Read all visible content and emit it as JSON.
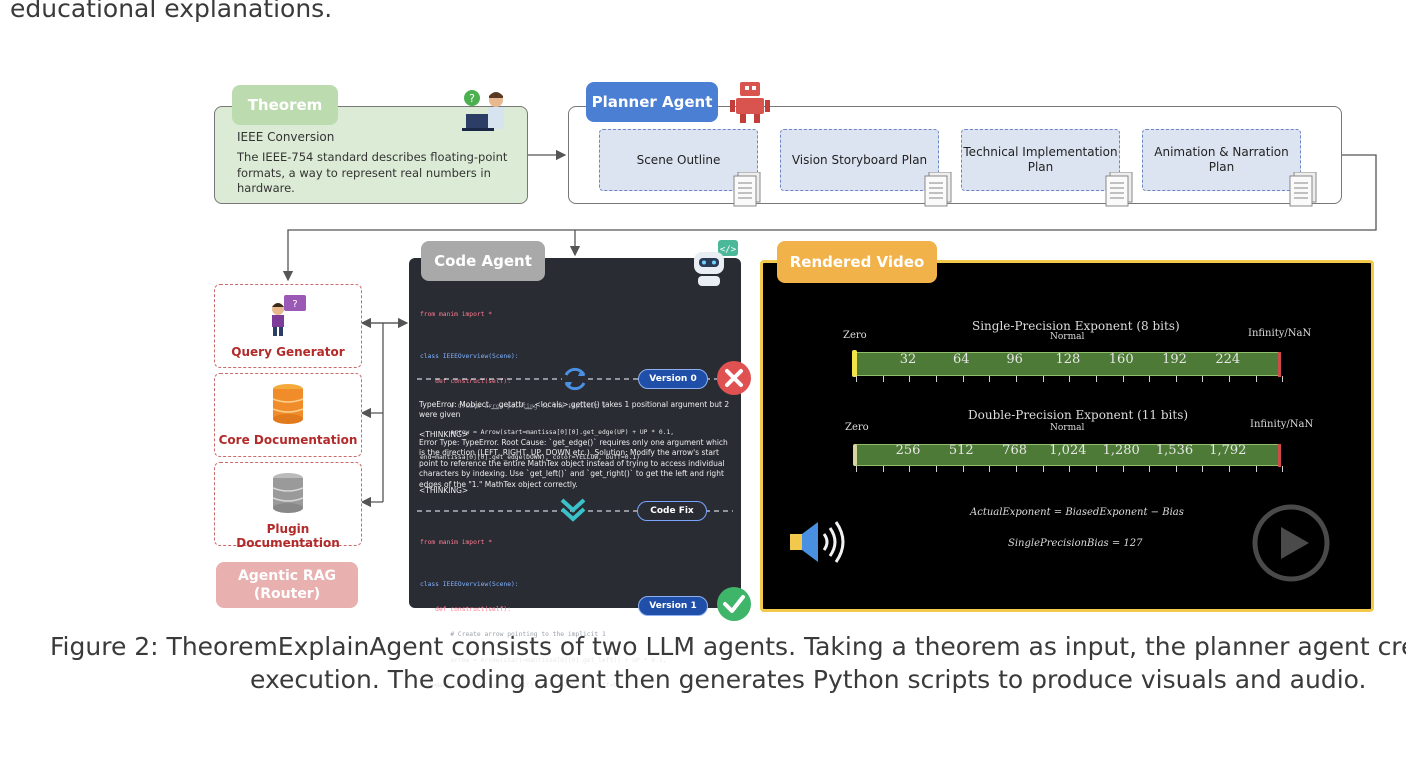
{
  "page": {
    "top_text": "educational explanations.",
    "caption_line1": "Figure 2: TheoremExplainAgent consists of two LLM agents. Taking a theorem as input, the planner agent creat",
    "caption_line2": "execution. The coding agent then generates Python scripts to produce visuals and audio."
  },
  "theorem": {
    "label": "Theorem",
    "title": "IEEE Conversion",
    "description": "The IEEE-754 standard describes floating-point formats, a way to represent real numbers in hardware."
  },
  "planner": {
    "label": "Planner Agent",
    "steps": [
      "Scene Outline",
      "Vision Storyboard Plan",
      "Technical Implementation Plan",
      "Animation & Narration Plan"
    ]
  },
  "rag": {
    "items": [
      "Query Generator",
      "Core Documentation",
      "Plugin Documentation"
    ],
    "router_label": "Agentic RAG (Router)"
  },
  "code_agent": {
    "label": "Code Agent",
    "code_v0": [
      "from manim import *",
      "",
      "class IEEEOverview(Scene):",
      "    def construct(self):",
      "        # Create arrow pointing to the implicit 1",
      "        arrow = Arrow(start=mantissa[0][0].get_edge(UP) + UP * 0.1,",
      "end=mantissa[0][0].get_edge(DOWN), color=YELLOW, buff=0.1)"
    ],
    "version0_label": "Version 0",
    "error_text": "TypeError: Mobject.__getattr__.<locals>.getter() takes 1 positional argument but 2 were given",
    "thinking_open": "<THINKING>",
    "thinking_text": "Error Type: TypeError. Root Cause: `get_edge()` requires only one argument which is the direction (LEFT, RIGHT, UP, DOWN etc.). Solution: Modify the arrow's start point to reference the entire MathTex object instead of trying to access individual characters by indexing. Use `get_left()` and `get_right()` to get the left and right edges of the \"1.\" MathTex object correctly.",
    "thinking_close": "<THINKING>",
    "code_fix_label": "Code Fix",
    "code_v1": [
      "from manim import *",
      "",
      "class IEEEOverview(Scene):",
      "    def construct(self):",
      "        # Create arrow pointing to the implicit 1",
      "        arrow = Arrow(start=mantissa[0][0].get_left() + UP * 0.1,",
      "end=mantissa[0][0].get_right(), color=YELLOW, buff=0.1)"
    ],
    "version1_label": "Version 1"
  },
  "video": {
    "label": "Rendered Video",
    "single": {
      "title": "Single-Precision Exponent (8 bits)",
      "zero": "Zero",
      "normal": "Normal",
      "inf": "Infinity/NaN",
      "ticks": [
        "32",
        "64",
        "96",
        "128",
        "160",
        "192",
        "224"
      ]
    },
    "double": {
      "title": "Double-Precision Exponent (11 bits)",
      "zero": "Zero",
      "normal": "Normal",
      "inf": "Infinity/NaN",
      "ticks": [
        "256",
        "512",
        "768",
        "1,024",
        "1,280",
        "1,536",
        "1,792"
      ]
    },
    "formula1": "ActualExponent = BiasedExponent − Bias",
    "formula2": "SinglePrecisionBias = 127"
  },
  "colors": {
    "theorem": "#bcdcb0",
    "planner": "#4a7fd4",
    "code": "#2a2c34",
    "video_border": "#f2c94c",
    "rag": "#c96b6b",
    "error": "#e05252",
    "success": "#3fb56a"
  }
}
